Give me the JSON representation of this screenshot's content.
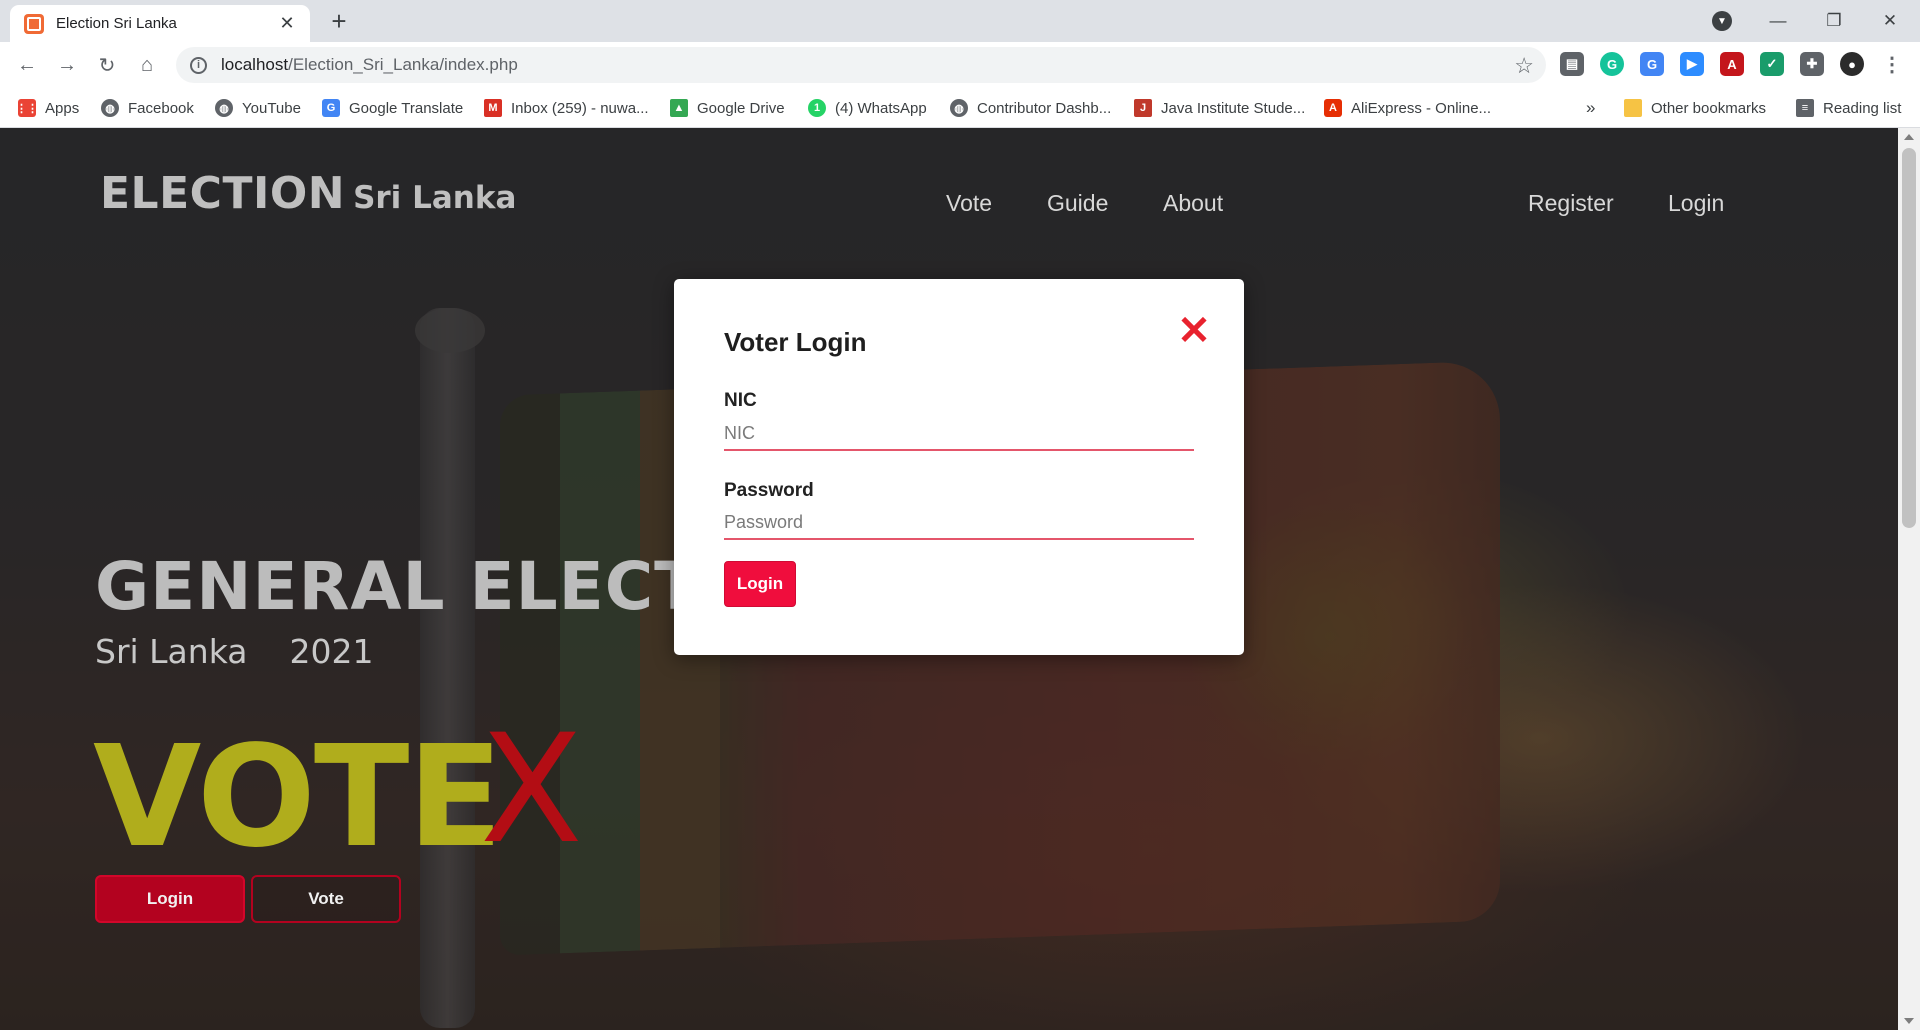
{
  "browser": {
    "tab_title": "Election Sri Lanka",
    "url_host": "localhost",
    "url_path": "/Election_Sri_Lanka/index.php"
  },
  "bookmarks": [
    {
      "label": "Apps",
      "icon": "apps-grid-icon",
      "color": "#ea4335"
    },
    {
      "label": "Facebook",
      "icon": "globe-icon",
      "color": "#5f6368"
    },
    {
      "label": "YouTube",
      "icon": "globe-icon",
      "color": "#5f6368"
    },
    {
      "label": "Google Translate",
      "icon": "translate-icon",
      "color": "#4285f4"
    },
    {
      "label": "Inbox (259) - nuwa...",
      "icon": "gmail-icon",
      "color": "#d93025"
    },
    {
      "label": "Google Drive",
      "icon": "drive-icon",
      "color": "#34a853"
    },
    {
      "label": "(4) WhatsApp",
      "icon": "whatsapp-icon",
      "color": "#25d366"
    },
    {
      "label": "Contributor Dashb...",
      "icon": "globe-icon",
      "color": "#5f6368"
    },
    {
      "label": "Java Institute Stude...",
      "icon": "java-icon",
      "color": "#c0392b"
    },
    {
      "label": "AliExpress - Online...",
      "icon": "aliexpress-icon",
      "color": "#e62e04"
    }
  ],
  "bookmarks_extra": {
    "overflow": "»",
    "other": "Other bookmarks",
    "reading": "Reading list"
  },
  "site": {
    "brand_main": "ELECTION",
    "brand_sub": "Sri Lanka",
    "nav": [
      "Vote",
      "Guide",
      "About"
    ],
    "auth": [
      "Register",
      "Login"
    ],
    "hero_title": "GENERAL ELECTION",
    "hero_country": "Sri Lanka",
    "hero_year": "2021",
    "vote_word": "VOTE",
    "vote_mark": "X",
    "hero_login": "Login",
    "hero_vote": "Vote"
  },
  "modal": {
    "title": "Voter Login",
    "close": "✕",
    "nic_label": "NIC",
    "nic_placeholder": "NIC",
    "password_label": "Password",
    "password_placeholder": "Password",
    "submit": "Login"
  },
  "colors": {
    "accent": "#f00d3d",
    "vote_yellow": "#b0ad1c",
    "vote_x_red": "#b30d14"
  }
}
